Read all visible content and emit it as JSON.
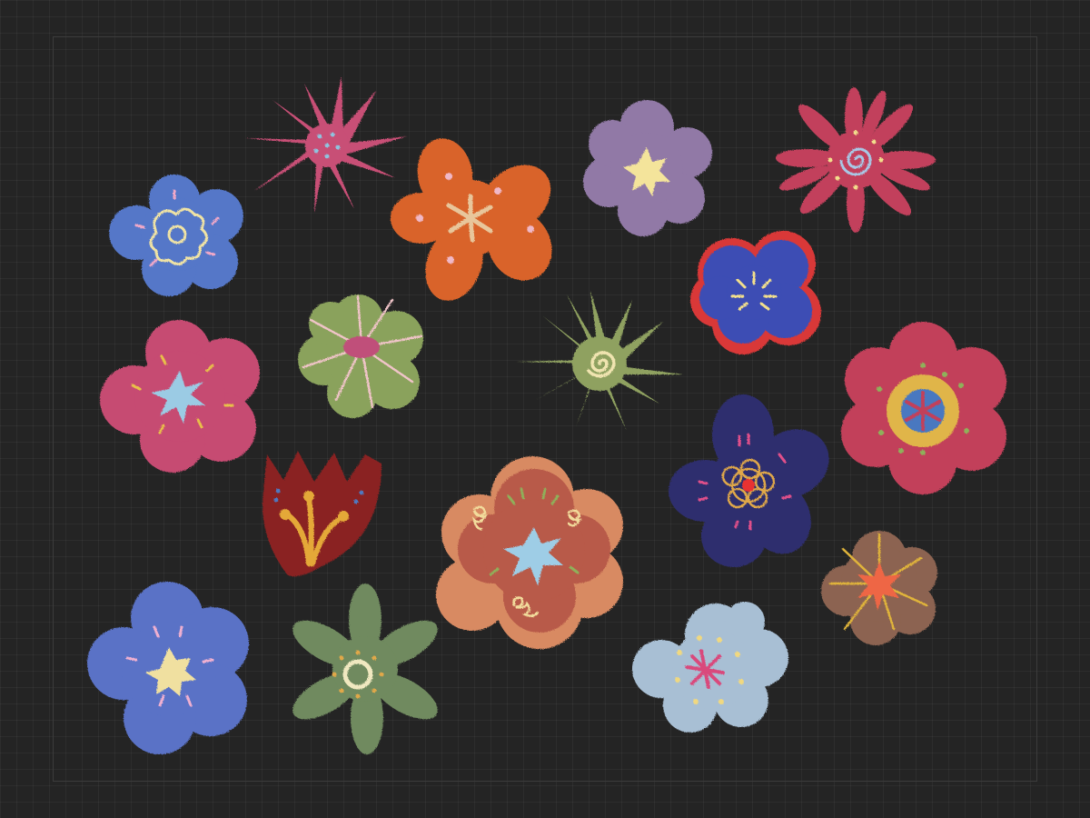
{
  "artwork": {
    "background": "#242424",
    "grid_color": "#333333",
    "flowers": [
      {
        "id": "pink-star",
        "kind": "spiky",
        "color": "#c84f76",
        "center": "dots",
        "center_color": "#8fc4df"
      },
      {
        "id": "blue-swirl",
        "kind": "round",
        "color": "#5477c8",
        "center": "loops",
        "center_color": "#f0e3a4"
      },
      {
        "id": "orange-five",
        "kind": "lobed",
        "color": "#d9642a",
        "center": "star",
        "center_color": "#e8c69b"
      },
      {
        "id": "lavender",
        "kind": "round",
        "color": "#9179a6",
        "center": "star",
        "center_color": "#f4e49b"
      },
      {
        "id": "crimson-spiral",
        "kind": "spiky",
        "color": "#c2405c",
        "center": "spiral",
        "center_color": "#a8c8e6"
      },
      {
        "id": "royal-blue-red-edge",
        "kind": "lobed",
        "color": "#3c4eb4",
        "outline": "#d93838",
        "center": "rays",
        "center_color": "#f2df8c"
      },
      {
        "id": "pink-blue-star",
        "kind": "round",
        "color": "#c64b72",
        "center": "star",
        "center_color": "#9bcbe4"
      },
      {
        "id": "sage-stripes",
        "kind": "round",
        "color": "#8aa25c",
        "center": "oval",
        "center_color": "#c0507a"
      },
      {
        "id": "olive-spiral",
        "kind": "spiky",
        "color": "#8fa160",
        "center": "spiral",
        "center_color": "#f0e4b0"
      },
      {
        "id": "crimson-yellow",
        "kind": "round",
        "color": "#c2405a",
        "center": "ring",
        "center_color": "#e0b54a"
      },
      {
        "id": "maroon-tulip",
        "kind": "tulip",
        "color": "#8a2222",
        "center": "stamens",
        "center_color": "#e4a838"
      },
      {
        "id": "terracotta",
        "kind": "round",
        "color": "#b85a48",
        "center": "star",
        "center_color": "#9ecde6"
      },
      {
        "id": "indigo",
        "kind": "lobed",
        "color": "#2e2f6e",
        "center": "loops",
        "center_color": "#e0a84a"
      },
      {
        "id": "brown-coral",
        "kind": "round",
        "color": "#8c6451",
        "center": "star",
        "center_color": "#ee6645"
      },
      {
        "id": "periwinkle",
        "kind": "round",
        "color": "#5a72c6",
        "center": "star",
        "center_color": "#f0e0a0"
      },
      {
        "id": "moss-ring",
        "kind": "spiky",
        "color": "#6f8a5e",
        "center": "ring",
        "center_color": "#f0e8c0"
      },
      {
        "id": "powder-blue",
        "kind": "lobed",
        "color": "#a8bfd4",
        "center": "star",
        "center_color": "#d9487c"
      }
    ]
  }
}
